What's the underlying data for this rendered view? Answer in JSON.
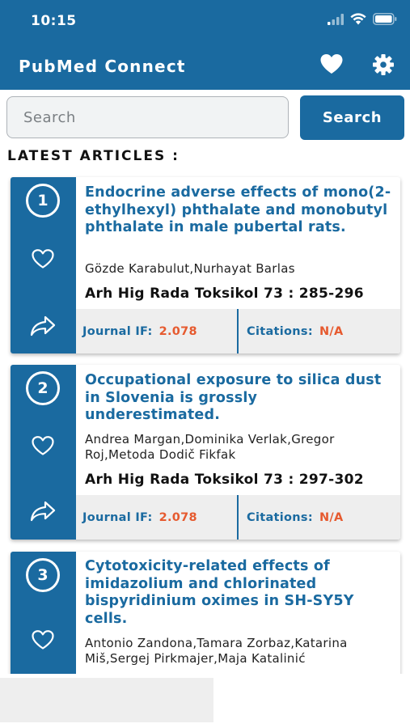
{
  "status_bar": {
    "time": "10:15"
  },
  "app": {
    "title": "PubMed Connect"
  },
  "search": {
    "placeholder": "Search",
    "value": "",
    "button_label": "Search"
  },
  "section": {
    "title": "LATEST ARTICLES :"
  },
  "articles": [
    {
      "number": "1",
      "title": "Endocrine adverse effects of mono(2-ethylhexyl) phthalate and monobutyl phthalate in male pubertal rats.",
      "authors": "Gözde Karabulut,Nurhayat Barlas",
      "citation": "Arh Hig Rada Toksikol 73 : 285-296",
      "journal_if_label": "Journal IF:",
      "journal_if_value": "2.078",
      "citations_label": "Citations:",
      "citations_value": "N/A"
    },
    {
      "number": "2",
      "title": "Occupational exposure to silica dust in Slovenia is grossly underestimated.",
      "authors": "Andrea Margan,Dominika Verlak,Gregor Roj,Metoda Dodič Fikfak",
      "citation": "Arh Hig Rada Toksikol 73 : 297-302",
      "journal_if_label": "Journal IF:",
      "journal_if_value": "2.078",
      "citations_label": "Citations:",
      "citations_value": "N/A"
    },
    {
      "number": "3",
      "title": "Cytotoxicity-related effects of imidazolium and chlorinated bispyridinium oximes in SH-SY5Y cells.",
      "authors": "Antonio Zandona,Tamara Zorbaz,Katarina Miš,Sergej Pirkmajer,Maja Katalinić"
    }
  ],
  "icons": {
    "favorites": "heart-icon",
    "settings": "gear-icon",
    "share": "share-icon",
    "signal": "signal-icon",
    "wifi": "wifi-icon",
    "battery": "battery-icon"
  },
  "colors": {
    "primary": "#1a6aa0",
    "accent_value": "#e65a2f",
    "footer_bg": "#eeeeee"
  }
}
